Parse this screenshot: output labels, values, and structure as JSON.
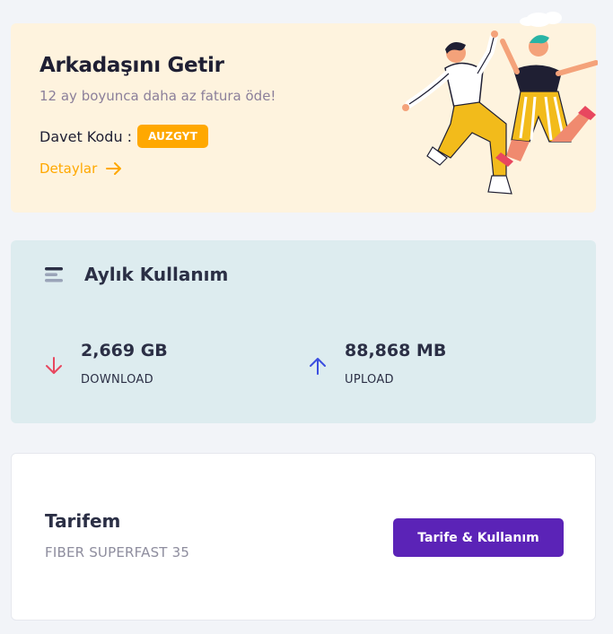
{
  "referral": {
    "title": "Arkadaşını Getir",
    "subtitle": "12 ay boyunca daha az fatura öde!",
    "code_label": "Davet Kodu :",
    "code": "AUZGYT",
    "details_label": "Detaylar",
    "accent_color": "#ffa800",
    "background_color": "#fef3de"
  },
  "usage": {
    "title": "Aylık Kullanım",
    "icon": "menu-lines-icon",
    "download": {
      "value": "2,669 GB",
      "label": "DOWNLOAD",
      "icon": "arrow-down-icon",
      "color": "#e8475f"
    },
    "upload": {
      "value": "88,868 MB",
      "label": "UPLOAD",
      "icon": "arrow-up-icon",
      "color": "#3b4ee0"
    },
    "background_color": "#ddecef"
  },
  "plan": {
    "title": "Tarifem",
    "name": "FIBER SUPERFAST 35",
    "button_label": "Tarife & Kullanım",
    "button_color": "#5b23b7"
  }
}
